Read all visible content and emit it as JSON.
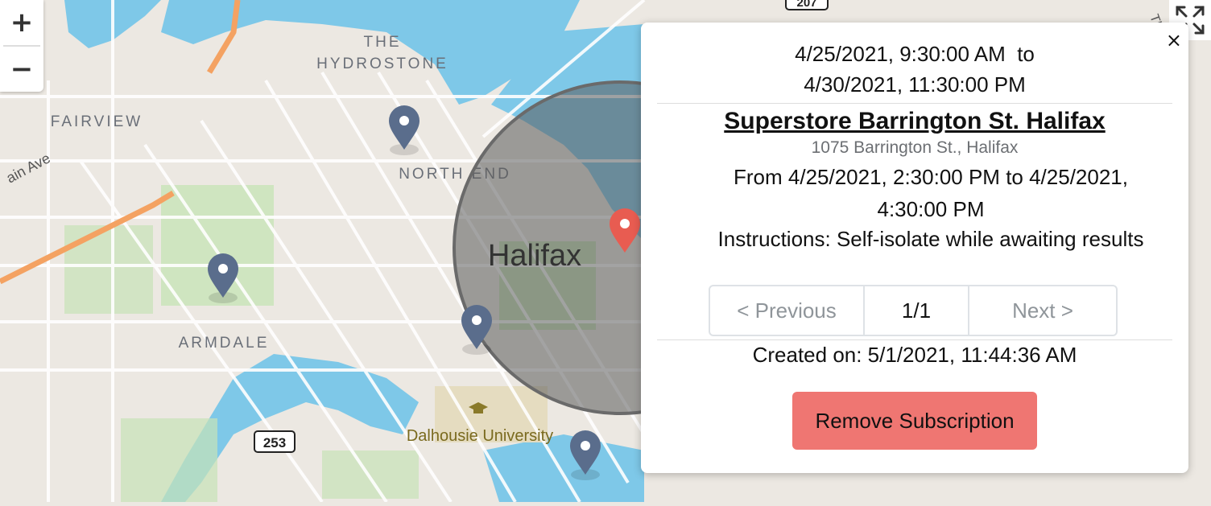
{
  "map": {
    "labels": {
      "the": "THE",
      "hydrostone": "HYDROSTONE",
      "fairview": "FAIRVIEW",
      "north_end": "NORTH END",
      "armdale": "ARMDALE",
      "halifax": "Halifax",
      "dalhousie": "Dalhousie University",
      "street": "ain Ave",
      "route_253": "253",
      "route_207": "207",
      "street_top": "Th"
    },
    "zoom_in": "+",
    "zoom_out": "−",
    "colors": {
      "water": "#7ec8e8",
      "land": "#ece8e2",
      "park": "#c8e3b8",
      "highway": "#f4a262",
      "marker": "#5a6d8c",
      "active_marker": "#e85c51",
      "radius": "#5c5c5c"
    }
  },
  "popup": {
    "close_label": "×",
    "range_line1": "4/25/2021, 9:30:00 AM  to",
    "range_line2": "4/30/2021, 11:30:00 PM",
    "location_name": "Superstore Barrington St. Halifax",
    "address": "1075 Barrington St., Halifax",
    "from_line1": "From 4/25/2021, 2:30:00 PM to 4/25/2021,",
    "from_line2": "4:30:00 PM",
    "instructions": "Instructions: Self-isolate while awaiting results",
    "pagination": {
      "prev": "< Previous",
      "current": "1/1",
      "next": "Next >"
    },
    "created": "Created on: 5/1/2021, 11:44:36 AM",
    "remove_button": "Remove Subscription",
    "button_color": "#ef7672"
  }
}
